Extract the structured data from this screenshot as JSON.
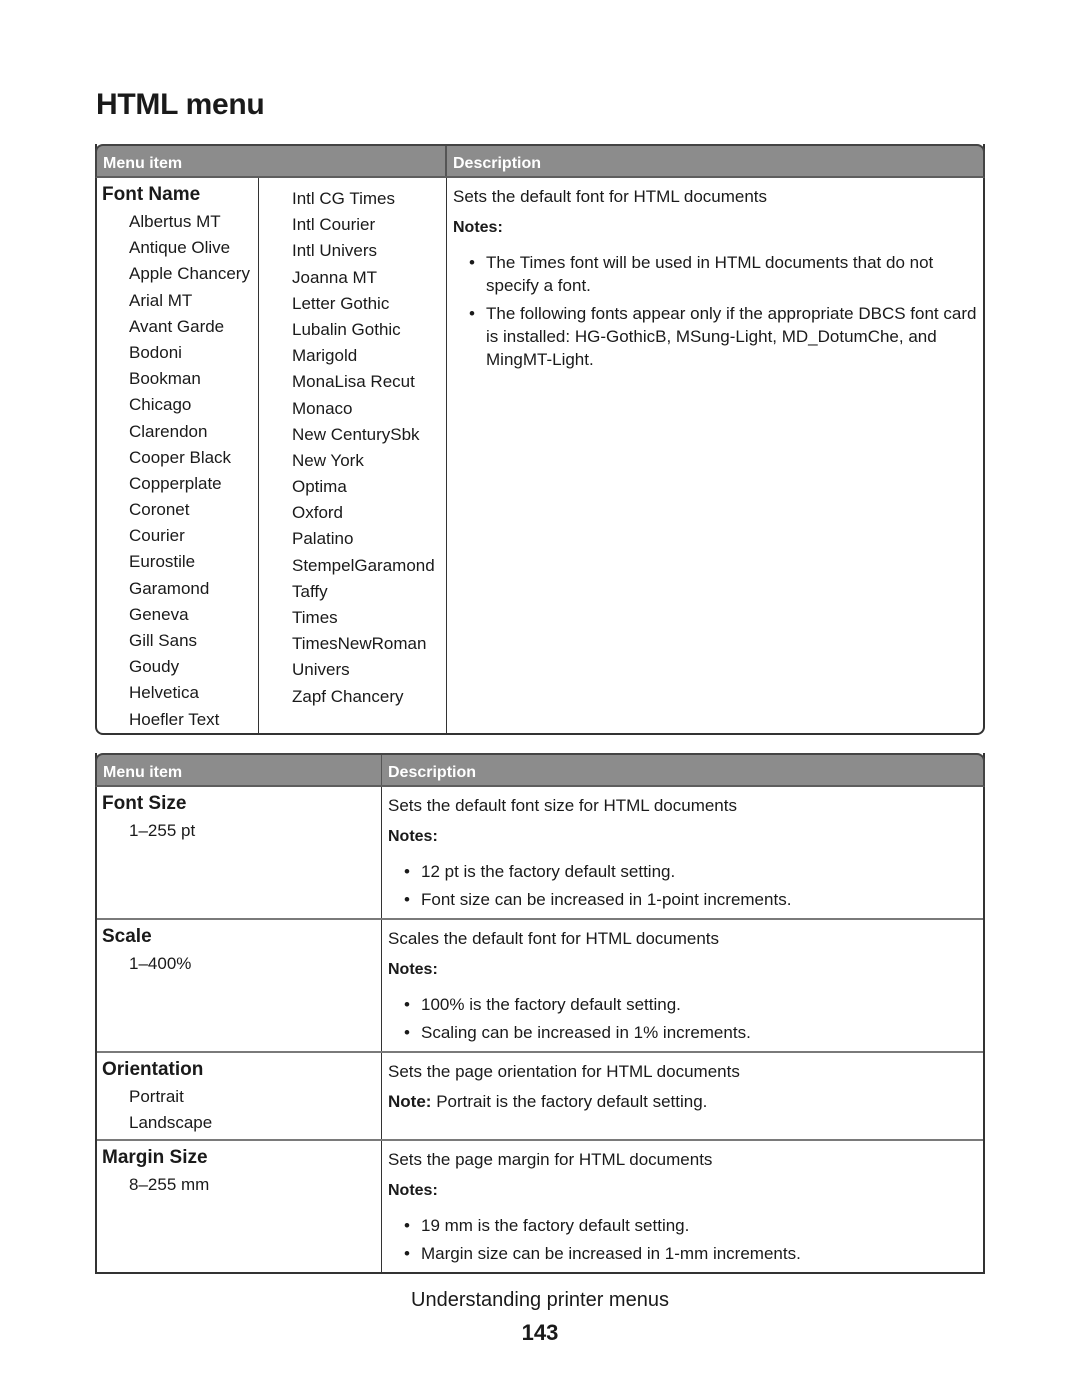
{
  "page_title": "HTML menu",
  "table1": {
    "headers": {
      "menu_item": "Menu item",
      "description": "Description"
    },
    "item": {
      "title": "Font Name",
      "options_col1": [
        "Albertus MT",
        "Antique Olive",
        "Apple Chancery",
        "Arial MT",
        "Avant Garde",
        "Bodoni",
        "Bookman",
        "Chicago",
        "Clarendon",
        "Cooper Black",
        "Copperplate",
        "Coronet",
        "Courier",
        "Eurostile",
        "Garamond",
        "Geneva",
        "Gill Sans",
        "Goudy",
        "Helvetica",
        "Hoefler Text"
      ],
      "options_col2": [
        "Intl CG Times",
        "Intl Courier",
        "Intl Univers",
        "Joanna MT",
        "Letter Gothic",
        "Lubalin Gothic",
        "Marigold",
        "MonaLisa Recut",
        "Monaco",
        "New CenturySbk",
        "New York",
        "Optima",
        "Oxford",
        "Palatino",
        "StempelGaramond",
        "Taffy",
        "Times",
        "TimesNewRoman",
        "Univers",
        "Zapf Chancery"
      ],
      "description": "Sets the default font for HTML documents",
      "notes_label": "Notes:",
      "notes": [
        "The Times font will be used in HTML documents that do not specify a font.",
        "The following fonts appear only if the appropriate DBCS font card is installed: HG-GothicB, MSung-Light, MD_DotumChe, and MingMT-Light."
      ]
    }
  },
  "table2": {
    "headers": {
      "menu_item": "Menu item",
      "description": "Description"
    },
    "rows": [
      {
        "title": "Font Size",
        "options": [
          "1–255 pt"
        ],
        "description": "Sets the default font size for HTML documents",
        "notes_label": "Notes:",
        "notes": [
          "12 pt is the factory default setting.",
          "Font size can be increased in 1-point increments."
        ]
      },
      {
        "title": "Scale",
        "options": [
          "1–400%"
        ],
        "description": "Scales the default font for HTML documents",
        "notes_label": "Notes:",
        "notes": [
          "100% is the factory default setting.",
          "Scaling can be increased in 1% increments."
        ]
      },
      {
        "title": "Orientation",
        "options": [
          "Portrait",
          "Landscape"
        ],
        "description": "Sets the page orientation for HTML documents",
        "note_label": "Note:",
        "note": "Portrait is the factory default setting."
      },
      {
        "title": "Margin Size",
        "options": [
          "8–255 mm"
        ],
        "description": "Sets the page margin for HTML documents",
        "notes_label": "Notes:",
        "notes": [
          "19 mm is the factory default setting.",
          "Margin size can be increased in 1-mm increments."
        ]
      }
    ]
  },
  "footer": {
    "section": "Understanding printer menus",
    "page_number": "143"
  }
}
